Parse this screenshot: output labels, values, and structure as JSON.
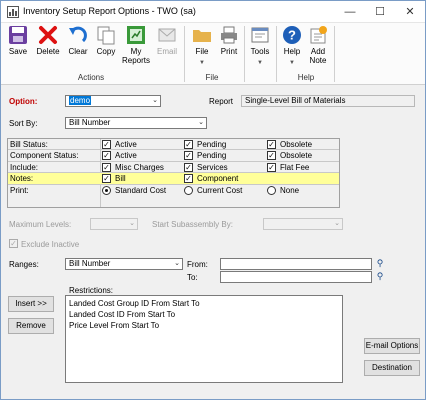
{
  "window": {
    "title": "Inventory Setup Report Options  -  TWO (sa)",
    "controls": [
      "minimize",
      "maximize",
      "close"
    ]
  },
  "ribbon": {
    "buttons": [
      {
        "label": "Save",
        "icon": "save-icon",
        "enabled": true
      },
      {
        "label": "Delete",
        "icon": "delete-icon",
        "enabled": true
      },
      {
        "label": "Clear",
        "icon": "clear-icon",
        "enabled": true
      },
      {
        "label": "Copy",
        "icon": "copy-icon",
        "enabled": true
      },
      {
        "label": "My Reports",
        "icon": "my-reports-icon",
        "enabled": true
      },
      {
        "label": "Email",
        "icon": "email-icon",
        "enabled": false
      },
      {
        "label": "File",
        "icon": "folder-icon",
        "enabled": true
      },
      {
        "label": "Print",
        "icon": "print-icon",
        "enabled": true
      },
      {
        "label": "Tools",
        "icon": "tools-icon",
        "enabled": true
      },
      {
        "label": "Help",
        "icon": "help-icon",
        "enabled": true
      },
      {
        "label": "Add Note",
        "icon": "add-note-icon",
        "enabled": true
      }
    ],
    "groups": [
      "Actions",
      "File",
      "Help"
    ]
  },
  "form": {
    "option_label": "Option:",
    "option_value": "demo",
    "report_label": "Report",
    "report_value": "Single-Level Bill of Materials",
    "sort_label": "Sort By:",
    "sort_value": "Bill Number",
    "grid_rows": [
      {
        "label": "Bill Status:",
        "options": [
          {
            "text": "Active",
            "checked": true
          },
          {
            "text": "Pending",
            "checked": true
          },
          {
            "text": "Obsolete",
            "checked": true
          }
        ]
      },
      {
        "label": "Component Status:",
        "options": [
          {
            "text": "Active",
            "checked": true
          },
          {
            "text": "Pending",
            "checked": true
          },
          {
            "text": "Obsolete",
            "checked": true
          }
        ]
      },
      {
        "label": "Include:",
        "options": [
          {
            "text": "Misc Charges",
            "checked": true
          },
          {
            "text": "Services",
            "checked": true
          },
          {
            "text": "Flat Fee",
            "checked": true
          }
        ]
      },
      {
        "label": "Notes:",
        "options": [
          {
            "text": "Bill",
            "checked": true
          },
          {
            "text": "Component",
            "checked": true
          }
        ]
      },
      {
        "label": "Print:",
        "options": [
          {
            "text": "Standard Cost",
            "selected": true
          },
          {
            "text": "Current Cost",
            "selected": false
          },
          {
            "text": "None",
            "selected": false
          }
        ]
      }
    ],
    "max_levels_label": "Maximum Levels:",
    "start_subassembly_label": "Start Subassembly By:",
    "exclude_inactive_label": "Exclude Inactive",
    "ranges_label": "Ranges:",
    "ranges_value": "Bill Number",
    "from_label": "From:",
    "to_label": "To:",
    "restrictions_label": "Restrictions:",
    "restrictions": [
      "Landed Cost Group ID From Start To",
      "Landed Cost ID From Start To",
      "Price Level From Start To"
    ],
    "insert_label": "Insert >>",
    "remove_label": "Remove",
    "email_options_label": "E-mail Options",
    "destination_label": "Destination"
  }
}
